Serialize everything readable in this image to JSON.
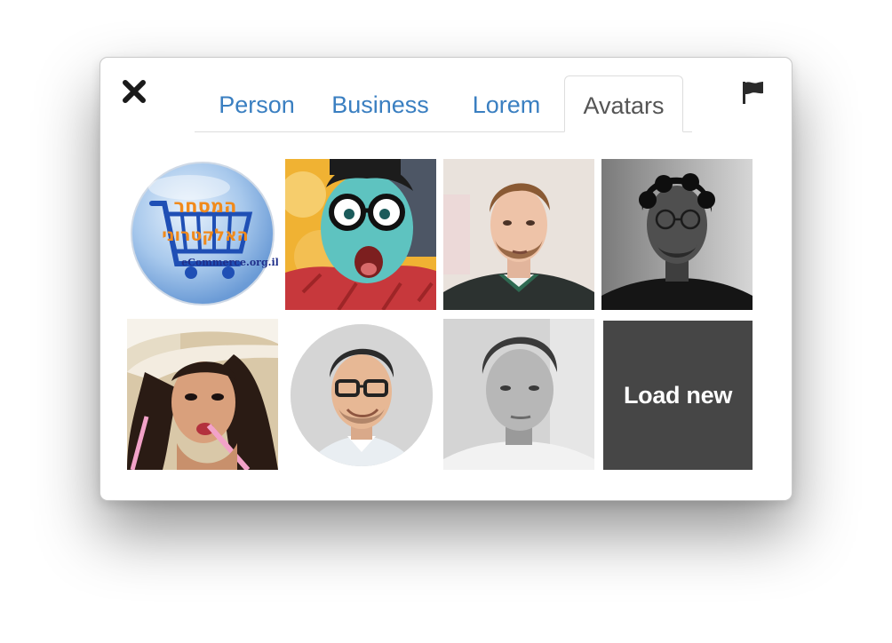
{
  "tabs": [
    "Person",
    "Business",
    "Lorem",
    "Avatars"
  ],
  "active_tab": "Avatars",
  "logo_badge": {
    "hebrew_top": "המסחר",
    "hebrew_bottom": "האלקטרוני",
    "domain": "eCommerce.org.il"
  },
  "load_new_label": "Load new",
  "icons": {
    "close": "close-icon",
    "flag": "flag-icon"
  },
  "colors": {
    "tab_link": "#3a7fc1",
    "tab_active": "#555555",
    "load_new_bg": "#464646"
  }
}
